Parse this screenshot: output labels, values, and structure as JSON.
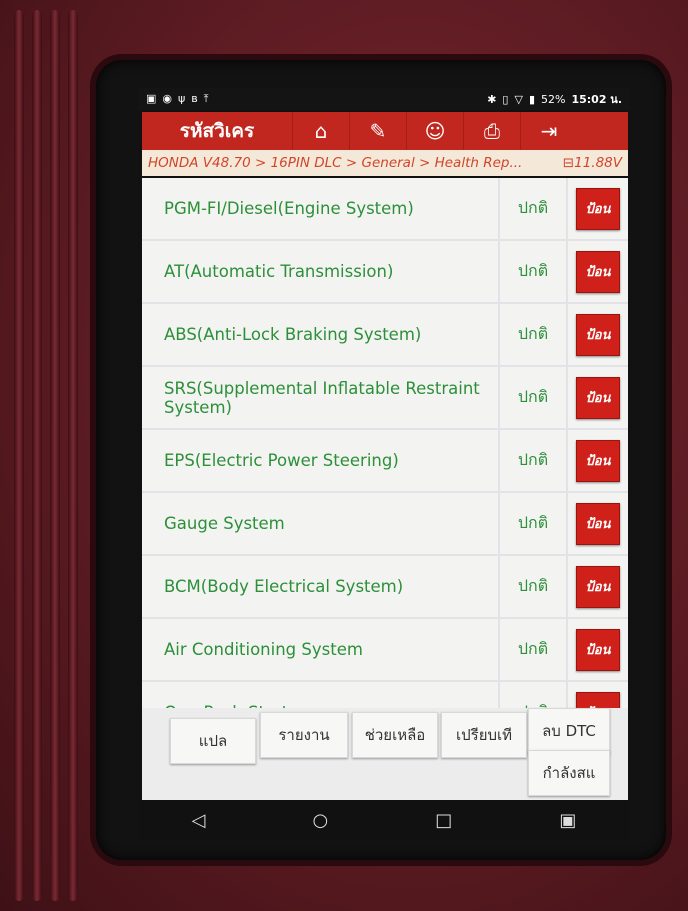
{
  "status_bar": {
    "left_icons": [
      "image-icon",
      "chat-icon",
      "usb-icon",
      "bluetooth-icon",
      "upload-icon"
    ],
    "battery": "52%",
    "time": "15:02 น."
  },
  "toolbar": {
    "title": "รหัสวิเคร",
    "buttons": [
      "home-icon",
      "edit-icon",
      "user-icon",
      "print-icon",
      "exit-icon"
    ]
  },
  "breadcrumb": {
    "path": "HONDA V48.70 > 16PIN DLC > General > Health Rep...",
    "voltage": "11.88V"
  },
  "systems": [
    {
      "name": "PGM-FI/Diesel(Engine System)",
      "status": "ปกติ",
      "action": "ป้อน"
    },
    {
      "name": "AT(Automatic Transmission)",
      "status": "ปกติ",
      "action": "ป้อน"
    },
    {
      "name": "ABS(Anti-Lock Braking System)",
      "status": "ปกติ",
      "action": "ป้อน"
    },
    {
      "name": "SRS(Supplemental Inflatable Restraint System)",
      "status": "ปกติ",
      "action": "ป้อน"
    },
    {
      "name": "EPS(Electric Power Steering)",
      "status": "ปกติ",
      "action": "ป้อน"
    },
    {
      "name": "Gauge System",
      "status": "ปกติ",
      "action": "ป้อน"
    },
    {
      "name": "BCM(Body Electrical System)",
      "status": "ปกติ",
      "action": "ป้อน"
    },
    {
      "name": "Air Conditioning System",
      "status": "ปกติ",
      "action": "ป้อน"
    },
    {
      "name": "One-Push Start",
      "status": "ปกติ",
      "action": "ป้อน"
    }
  ],
  "bottom_buttons": {
    "translate": "แปล",
    "report": "รายงาน",
    "help": "ช่วยเหลือ",
    "compare": "เปรียบเที",
    "clear_dtc": "ลบ DTC",
    "loading": "กำลังสแ"
  },
  "nav": [
    "back-icon",
    "home-circle-icon",
    "recents-icon",
    "screenshot-icon"
  ]
}
